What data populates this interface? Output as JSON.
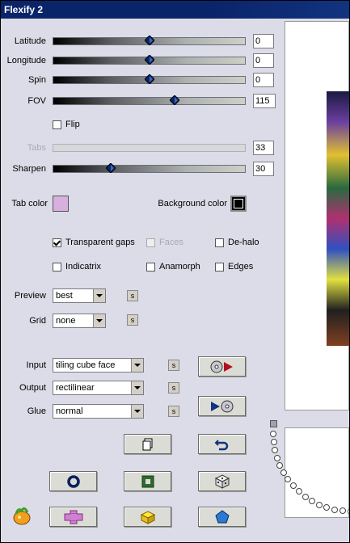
{
  "window": {
    "title": "Flexify 2"
  },
  "sliders": [
    {
      "label": "Latitude",
      "value": "0",
      "position": 0.5,
      "enabled": true
    },
    {
      "label": "Longitude",
      "value": "0",
      "position": 0.5,
      "enabled": true
    },
    {
      "label": "Spin",
      "value": "0",
      "position": 0.5,
      "enabled": true
    },
    {
      "label": "FOV",
      "value": "115",
      "position": 0.635,
      "enabled": true
    },
    {
      "label": "Tabs",
      "value": "33",
      "position": 0.0,
      "enabled": false
    },
    {
      "label": "Sharpen",
      "value": "30",
      "position": 0.3,
      "enabled": true
    }
  ],
  "flip": {
    "label": "Flip",
    "checked": false
  },
  "colors": {
    "tab_color_label": "Tab color",
    "tab_color": "#d8b0e0",
    "background_color_label": "Background color",
    "background_color": "#000000"
  },
  "options": {
    "transparent_gaps": {
      "label": "Transparent gaps",
      "checked": true
    },
    "faces": {
      "label": "Faces",
      "checked": false,
      "enabled": false
    },
    "de_halo": {
      "label": "De-halo",
      "checked": false
    },
    "indicatrix": {
      "label": "Indicatrix",
      "checked": false
    },
    "anamorph": {
      "label": "Anamorph",
      "checked": false
    },
    "edges": {
      "label": "Edges",
      "checked": false
    }
  },
  "preview": {
    "label": "Preview",
    "value": "best",
    "s_label": "s"
  },
  "grid": {
    "label": "Grid",
    "value": "none",
    "s_label": "s"
  },
  "input": {
    "label": "Input",
    "value": "tiling cube face",
    "s_label": "s"
  },
  "output": {
    "label": "Output",
    "value": "rectilinear",
    "s_label": "s"
  },
  "glue": {
    "label": "Glue",
    "value": "normal",
    "s_label": "s"
  },
  "icons": {
    "play_forward": "disc-play-icon",
    "play_back": "play-disc-icon",
    "copy": "copy-icon",
    "undo": "undo-icon",
    "circle": "ring-icon",
    "square": "square-icon",
    "dice": "dice-icon",
    "logo": "flexify-logo-icon",
    "cross": "cross-icon",
    "cube": "cube-icon",
    "pentagon": "pentagon-icon"
  }
}
